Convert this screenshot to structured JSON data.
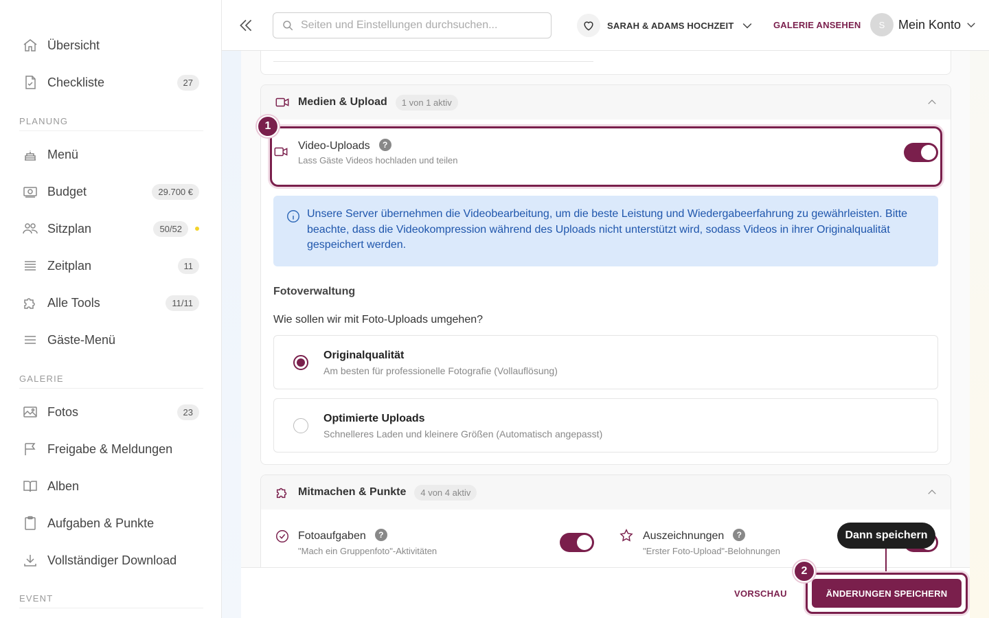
{
  "sidebar": {
    "items": [
      {
        "label": "Übersicht",
        "icon": "home-icon"
      },
      {
        "label": "Checkliste",
        "icon": "checklist-icon",
        "badge": "27"
      }
    ],
    "sections": [
      {
        "title": "PLANUNG",
        "items": [
          {
            "label": "Menü",
            "icon": "cake-icon"
          },
          {
            "label": "Budget",
            "icon": "money-icon",
            "badge": "29.700 €"
          },
          {
            "label": "Sitzplan",
            "icon": "people-icon",
            "badge": "50/52",
            "indicator_color": "#f3d32a"
          },
          {
            "label": "Zeitplan",
            "icon": "list-icon",
            "badge": "11"
          },
          {
            "label": "Alle Tools",
            "icon": "puzzle-icon",
            "badge": "11/11"
          },
          {
            "label": "Gäste-Menü",
            "icon": "menu-icon"
          }
        ]
      },
      {
        "title": "GALERIE",
        "items": [
          {
            "label": "Fotos",
            "icon": "image-icon",
            "badge": "23"
          },
          {
            "label": "Freigabe & Meldungen",
            "icon": "flag-icon"
          },
          {
            "label": "Alben",
            "icon": "book-icon"
          },
          {
            "label": "Aufgaben & Punkte",
            "icon": "clipboard-icon"
          },
          {
            "label": "Vollständiger Download",
            "icon": "download-icon"
          }
        ]
      },
      {
        "title": "EVENT",
        "items": []
      }
    ]
  },
  "topbar": {
    "search_placeholder": "Seiten und Einstellungen durchsuchen...",
    "event_name": "SARAH & ADAMS HOCHZEIT",
    "gallery_link": "GALERIE ANSEHEN",
    "account_initial": "S",
    "account_label": "Mein Konto"
  },
  "media": {
    "title": "Medien & Upload",
    "status": "1 von 1 aktiv",
    "video_uploads": {
      "title": "Video-Uploads",
      "help": "?",
      "description": "Lass Gäste Videos hochladen und teilen",
      "enabled": true
    },
    "info": "Unsere Server übernehmen die Videobearbeitung, um die beste Leistung und Wiedergabeerfahrung zu gewährleisten. Bitte beachte, dass die Videokompression während des Uploads nicht unterstützt wird, sodass Videos in ihrer Originalqualität gespeichert werden.",
    "photo_section_title": "Fotoverwaltung",
    "photo_question": "Wie sollen wir mit Foto-Uploads umgehen?",
    "options": [
      {
        "title": "Originalqualität",
        "description": "Am besten für professionelle Fotografie (Vollauflösung)",
        "selected": true
      },
      {
        "title": "Optimierte Uploads",
        "description": "Schnelleres Laden und kleinere Größen (Automatisch angepasst)",
        "selected": false
      }
    ]
  },
  "participation": {
    "title": "Mitmachen & Punkte",
    "status": "4 von 4 aktiv",
    "features": [
      {
        "title": "Fotoaufgaben",
        "help": "?",
        "description": "\"Mach ein Gruppenfoto\"-Aktivitäten",
        "icon": "check-circle-icon",
        "enabled": true
      },
      {
        "title": "Auszeichnungen",
        "help": "?",
        "description": "\"Erster Foto-Upload\"-Belohnungen",
        "icon": "star-icon",
        "enabled": true
      }
    ]
  },
  "footer": {
    "preview_label": "VORSCHAU",
    "save_label": "ÄNDERUNGEN SPEICHERN"
  },
  "annotations": {
    "step1": "1",
    "step2": "2",
    "tooltip": "Dann speichern"
  },
  "colors": {
    "brand": "#7a1f4c",
    "info_bg": "#dbe9fb",
    "info_text": "#1f56ac"
  }
}
